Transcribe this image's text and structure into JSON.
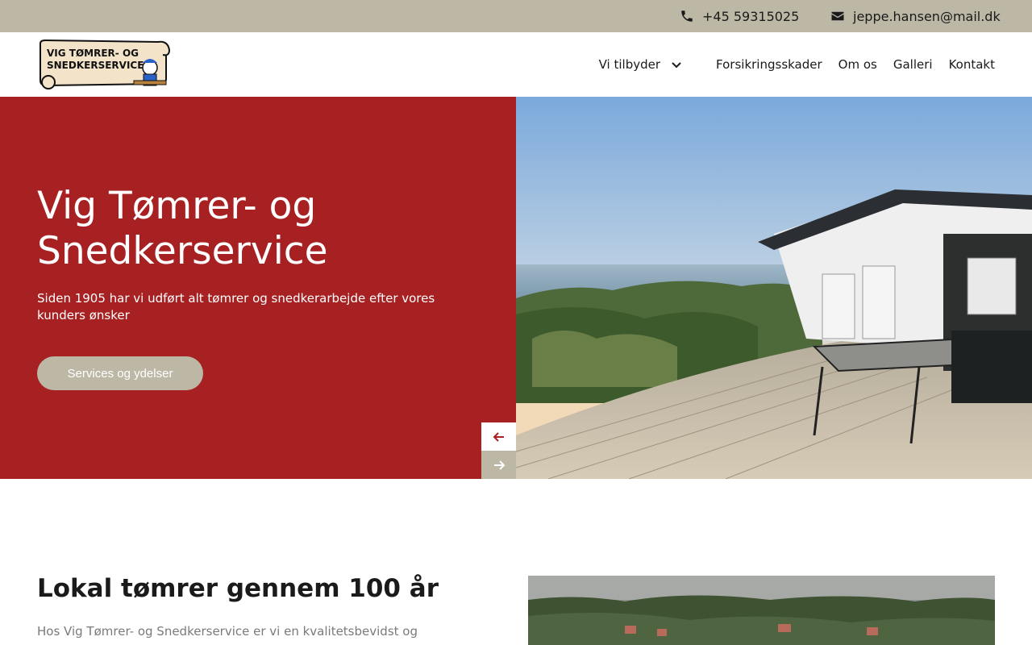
{
  "topbar": {
    "phone": "+45 59315025",
    "email": "jeppe.hansen@mail.dk"
  },
  "header": {
    "logo_text_line1": "VIG TØMRER- OG",
    "logo_text_line2": "SNEDKERSERVICE",
    "nav": {
      "offer": "Vi tilbyder",
      "insurance": "Forsikringsskader",
      "about": "Om os",
      "gallery": "Galleri",
      "contact": "Kontakt"
    }
  },
  "hero": {
    "title": "Vig Tømrer- og Snedkerservice",
    "subtitle": "Siden 1905 har vi udført alt tømrer og snedkerarbejde efter vores kunders ønsker",
    "button": "Services og ydelser"
  },
  "section": {
    "title": "Lokal tømrer gennem 100 år",
    "body": "Hos Vig Tømrer- og Snedkerservice er vi en kvalitetsbevidst og"
  },
  "colors": {
    "accent": "#a72022",
    "beige": "#bcb8a5",
    "text": "#1a1a1a"
  }
}
